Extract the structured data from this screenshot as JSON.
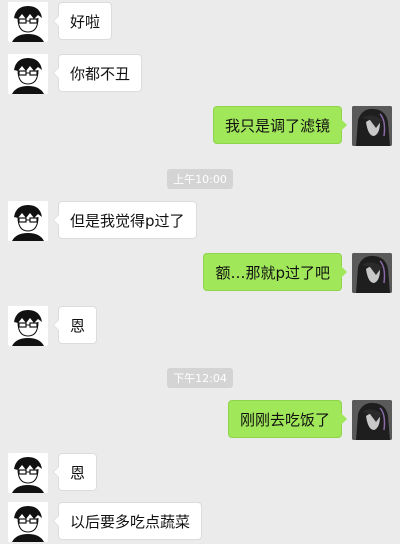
{
  "messages": [
    {
      "side": "left",
      "text": "好啦"
    },
    {
      "side": "left",
      "text": "你都不丑"
    },
    {
      "side": "right",
      "text": "我只是调了滤镜"
    },
    {
      "side": "left",
      "text": "但是我觉得p过了"
    },
    {
      "side": "right",
      "text": "额…那就p过了吧"
    },
    {
      "side": "left",
      "text": "恩"
    },
    {
      "side": "right",
      "text": "刚刚去吃饭了"
    },
    {
      "side": "left",
      "text": "恩"
    },
    {
      "side": "left",
      "text": "以后要多吃点蔬菜"
    }
  ],
  "time_separators": [
    "上午10:00",
    "下午12:04"
  ],
  "colors": {
    "background": "#ebebeb",
    "incoming_bubble": "#ffffff",
    "outgoing_bubble": "#a0e75a",
    "time_pill": "#d4d4d4"
  },
  "icons": {
    "incoming_avatar": "anime-boy-sketch-avatar",
    "outgoing_avatar": "girl-hair-portrait-avatar"
  }
}
